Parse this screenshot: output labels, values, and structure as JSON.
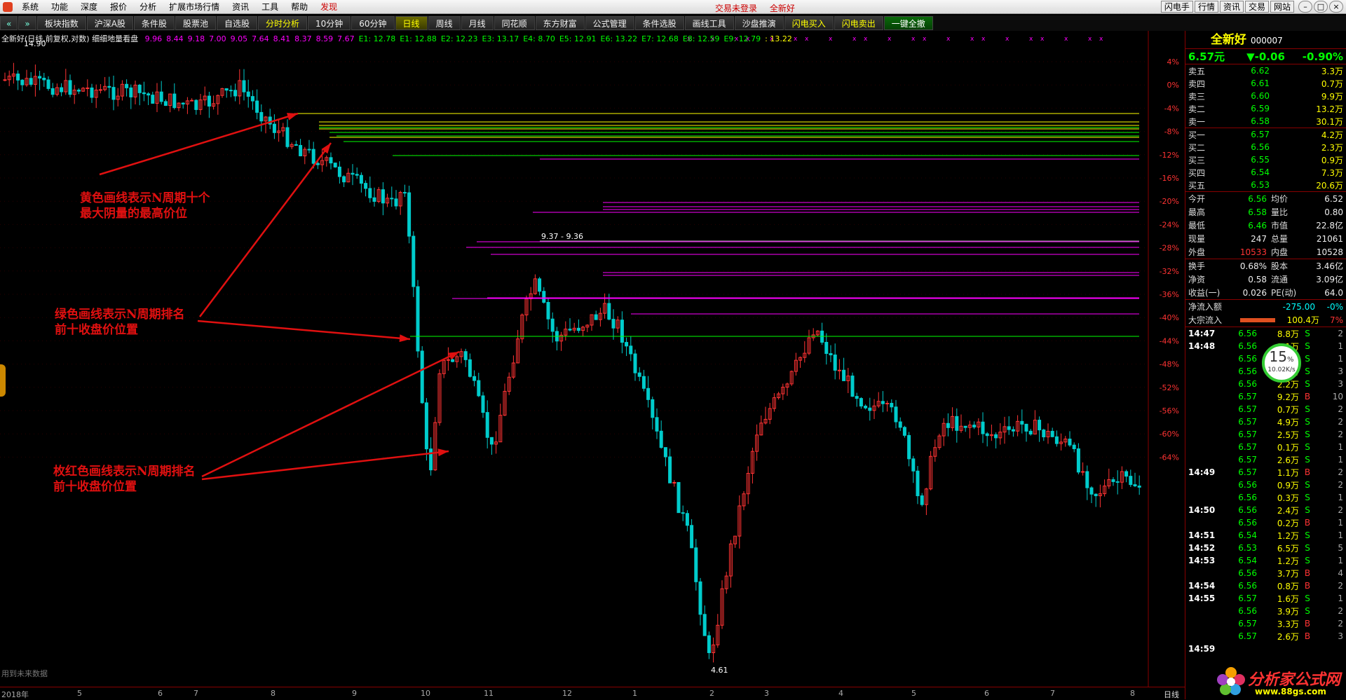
{
  "menu": {
    "items": [
      "系统",
      "功能",
      "深度",
      "报价",
      "分析",
      "扩展市场行情",
      "资讯",
      "工具",
      "帮助",
      "发现"
    ],
    "center": [
      "交易未登录",
      "全新好"
    ],
    "right_buttons": [
      "闪电手",
      "行情",
      "资讯",
      "交易",
      "网站"
    ]
  },
  "tabs": [
    "板块指数",
    "沪深A股",
    "条件股",
    "股票池",
    "自选股",
    "分时分析",
    "10分钟",
    "60分钟",
    "日线",
    "周线",
    "月线",
    "同花顺",
    "东方财富",
    "公式管理",
    "条件选股",
    "画线工具",
    "沙盘推演",
    "闪电买入",
    "闪电卖出",
    "一键全撤"
  ],
  "active_tab": "日线",
  "chart": {
    "info_title": "全新好(日线,前复权,对数) 细细地量看盘",
    "info_values": [
      {
        "text": "9.96",
        "color": "#ff00ff"
      },
      {
        "text": "8.44",
        "color": "#ff00ff"
      },
      {
        "text": "9.18",
        "color": "#ff00ff"
      },
      {
        "text": "7.00",
        "color": "#ff00ff"
      },
      {
        "text": "9.05",
        "color": "#ff00ff"
      },
      {
        "text": "7.64",
        "color": "#ff00ff"
      },
      {
        "text": "8.41",
        "color": "#ff00ff"
      },
      {
        "text": "8.37",
        "color": "#ff00ff"
      },
      {
        "text": "8.59",
        "color": "#ff00ff"
      },
      {
        "text": "7.67",
        "color": "#ff00ff"
      },
      {
        "text": "E1: 12.78",
        "color": "#00ff00"
      },
      {
        "text": "E1: 12.88",
        "color": "#00ff00"
      },
      {
        "text": "E2: 12.23",
        "color": "#00ff00"
      },
      {
        "text": "E3: 13.17",
        "color": "#00ff00"
      },
      {
        "text": "E4: 8.70",
        "color": "#00ff00"
      },
      {
        "text": "E5: 12.91",
        "color": "#00ff00"
      },
      {
        "text": "E6: 13.22",
        "color": "#00ff00"
      },
      {
        "text": "E7: 12.68",
        "color": "#00ff00"
      },
      {
        "text": "E8: 12.59",
        "color": "#00ff00"
      },
      {
        "text": "E9: 12.79",
        "color": "#00ff00"
      },
      {
        "text": ": 13.22",
        "color": "#ffff00"
      }
    ],
    "high_label": "14.90",
    "low_label": "4.61",
    "range_label": "9.37 - 9.36",
    "y_axis_labels": [
      "4%",
      "0%",
      "-4%",
      "-8%",
      "-12%",
      "-16%",
      "-20%",
      "-24%",
      "-28%",
      "-32%",
      "-36%",
      "-40%",
      "-44%",
      "-48%",
      "-52%",
      "-56%",
      "-60%",
      "-64%"
    ],
    "x_axis_labels": [
      "2018年",
      "5",
      "6",
      "7",
      "8",
      "9",
      "10",
      "11",
      "12",
      "1",
      "2",
      "3",
      "4",
      "5",
      "6",
      "7",
      "8"
    ],
    "period": "日线",
    "footer_note": "用到未来数据",
    "colors": {
      "up": "#ff3333",
      "down": "#00cccc",
      "yellow_line": "#ffff00",
      "green_line": "#00ff00",
      "magenta_line": "#ff00ff"
    }
  },
  "annotations": {
    "yellow": "黄色画线表示N周期十个最大阴量的最高价位",
    "green": "绿色画线表示N周期排名前十收盘价位置",
    "magenta": "枚红色画线表示N周期排名前十收盘价位置"
  },
  "quote": {
    "name": "全新好",
    "code": "000007",
    "price": "6.57元",
    "change": "▼-0.06",
    "pct": "-0.90%",
    "asks": [
      {
        "label": "卖五",
        "price": "6.62",
        "qty": "3.3万"
      },
      {
        "label": "卖四",
        "price": "6.61",
        "qty": "0.7万"
      },
      {
        "label": "卖三",
        "price": "6.60",
        "qty": "9.9万"
      },
      {
        "label": "卖二",
        "price": "6.59",
        "qty": "13.2万"
      },
      {
        "label": "卖一",
        "price": "6.58",
        "qty": "30.1万"
      }
    ],
    "bids": [
      {
        "label": "买一",
        "price": "6.57",
        "qty": "4.2万"
      },
      {
        "label": "买二",
        "price": "6.56",
        "qty": "2.3万"
      },
      {
        "label": "买三",
        "price": "6.55",
        "qty": "0.9万"
      },
      {
        "label": "买四",
        "price": "6.54",
        "qty": "7.3万"
      },
      {
        "label": "买五",
        "price": "6.53",
        "qty": "20.6万"
      }
    ],
    "stats": [
      {
        "a": "今开",
        "b": "6.56",
        "c": "均价",
        "d": "6.52"
      },
      {
        "a": "最高",
        "b": "6.58",
        "c": "量比",
        "d": "0.80"
      },
      {
        "a": "最低",
        "b": "6.46",
        "c": "市值",
        "d": "22.8亿"
      },
      {
        "a": "现量",
        "b": "247",
        "c": "总量",
        "d": "21061"
      },
      {
        "a": "外盘",
        "b": "10533",
        "c": "内盘",
        "d": "10528"
      }
    ],
    "fund": [
      {
        "a": "换手",
        "b": "0.68%",
        "c": "股本",
        "d": "3.46亿"
      },
      {
        "a": "净资",
        "b": "0.58",
        "c": "流通",
        "d": "3.09亿"
      },
      {
        "a": "收益(一)",
        "b": "0.026",
        "c": "PE(动)",
        "d": "64.0"
      }
    ],
    "flow": {
      "net_label": "净流入额",
      "net_value": "-275.00",
      "net_pct": "-0%",
      "block_label": "大宗流入",
      "block_value": "100.4万",
      "block_pct": "7%"
    },
    "speed": {
      "pct": "15",
      "unit": "%",
      "rate": "10.02K/s"
    },
    "ticks": [
      {
        "t": "14:47",
        "p": "6.56",
        "v": "8.8万",
        "bs": "S",
        "n": "2"
      },
      {
        "t": "14:48",
        "p": "6.56",
        "v": "1.1万",
        "bs": "S",
        "n": "1"
      },
      {
        "t": "",
        "p": "6.56",
        "v": "0.5万",
        "bs": "S",
        "n": "1"
      },
      {
        "t": "",
        "p": "6.56",
        "v": "1.2万",
        "bs": "S",
        "n": "3"
      },
      {
        "t": "",
        "p": "6.56",
        "v": "2.2万",
        "bs": "S",
        "n": "3"
      },
      {
        "t": "",
        "p": "6.57",
        "v": "9.2万",
        "bs": "B",
        "n": "10"
      },
      {
        "t": "",
        "p": "6.57",
        "v": "0.7万",
        "bs": "S",
        "n": "2"
      },
      {
        "t": "",
        "p": "6.57",
        "v": "4.9万",
        "bs": "S",
        "n": "2"
      },
      {
        "t": "",
        "p": "6.57",
        "v": "2.5万",
        "bs": "S",
        "n": "2"
      },
      {
        "t": "",
        "p": "6.57",
        "v": "0.1万",
        "bs": "S",
        "n": "1"
      },
      {
        "t": "",
        "p": "6.57",
        "v": "2.6万",
        "bs": "S",
        "n": "1"
      },
      {
        "t": "14:49",
        "p": "6.57",
        "v": "1.1万",
        "bs": "B",
        "n": "2"
      },
      {
        "t": "",
        "p": "6.56",
        "v": "0.9万",
        "bs": "S",
        "n": "2"
      },
      {
        "t": "",
        "p": "6.56",
        "v": "0.3万",
        "bs": "S",
        "n": "1"
      },
      {
        "t": "14:50",
        "p": "6.56",
        "v": "2.4万",
        "bs": "S",
        "n": "2"
      },
      {
        "t": "",
        "p": "6.56",
        "v": "0.2万",
        "bs": "B",
        "n": "1"
      },
      {
        "t": "14:51",
        "p": "6.54",
        "v": "1.2万",
        "bs": "S",
        "n": "1"
      },
      {
        "t": "14:52",
        "p": "6.53",
        "v": "6.5万",
        "bs": "S",
        "n": "5"
      },
      {
        "t": "14:53",
        "p": "6.54",
        "v": "1.2万",
        "bs": "S",
        "n": "1"
      },
      {
        "t": "",
        "p": "6.56",
        "v": "3.7万",
        "bs": "B",
        "n": "4"
      },
      {
        "t": "14:54",
        "p": "6.56",
        "v": "0.8万",
        "bs": "B",
        "n": "2"
      },
      {
        "t": "14:55",
        "p": "6.57",
        "v": "1.6万",
        "bs": "S",
        "n": "1"
      },
      {
        "t": "",
        "p": "6.56",
        "v": "3.9万",
        "bs": "S",
        "n": "2"
      },
      {
        "t": "",
        "p": "6.57",
        "v": "3.3万",
        "bs": "B",
        "n": "2"
      },
      {
        "t": "",
        "p": "6.57",
        "v": "2.6万",
        "bs": "B",
        "n": "3"
      },
      {
        "t": "14:59",
        "p": "",
        "v": "",
        "bs": "",
        "n": ""
      }
    ]
  },
  "watermark": {
    "title": "分析家公式网",
    "url": "www.88gs.com"
  }
}
